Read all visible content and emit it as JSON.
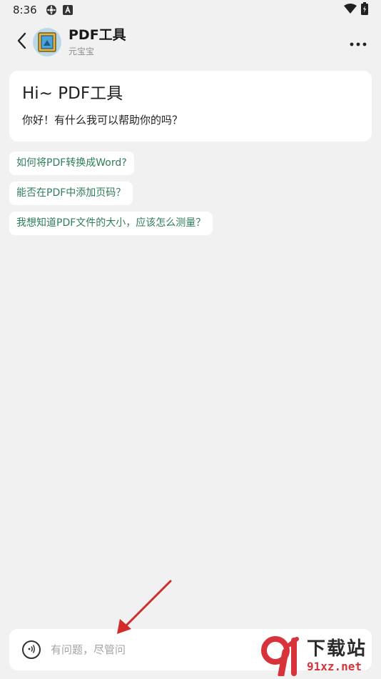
{
  "status_bar": {
    "time": "8:36"
  },
  "header": {
    "title": "PDF工具",
    "subtitle": "元宝宝"
  },
  "welcome": {
    "title": "Hi~ PDF工具",
    "message": "你好！有什么我可以帮助你的吗？"
  },
  "suggestions": [
    {
      "label": "如何将PDF转换成Word?"
    },
    {
      "label": "能否在PDF中添加页码？"
    },
    {
      "label": "我想知道PDF文件的大小，应该怎么测量？"
    }
  ],
  "input": {
    "placeholder": "有问题，尽管问"
  },
  "watermark": {
    "brand": "下载站",
    "domain": "91xz.net"
  },
  "colors": {
    "accent_text": "#2f7d5b",
    "annotation_arrow": "#d42a2a",
    "background": "#f1f1f1"
  },
  "icons": [
    "wifi-icon",
    "battery-icon",
    "back-arrow-icon",
    "more-dots-icon",
    "voice-icon"
  ]
}
